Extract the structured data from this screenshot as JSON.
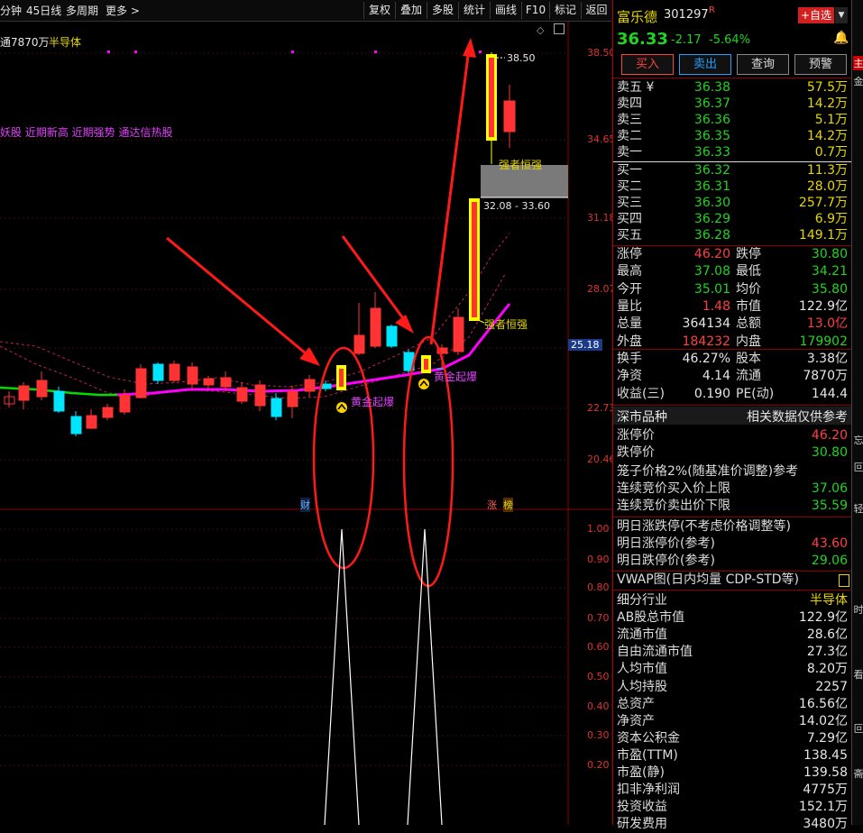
{
  "toolbar": {
    "left_items": [
      "分钟",
      "45日线",
      "多周期",
      "更多 >"
    ],
    "right_items": [
      "复权",
      "叠加",
      "多股",
      "统计",
      "画线",
      "F10",
      "标记",
      "返回"
    ]
  },
  "chart": {
    "info_line": "通7870万",
    "sector_tag": "半导体",
    "concept_line": "妖股 近期新高 近期强势 通达信热股",
    "y_axis": [
      "38.50",
      "34.65",
      "31.18",
      "28.07",
      "22.73",
      "20.46"
    ],
    "current_price_tag": "25.18",
    "lower_axis": [
      "1.00",
      "0.90",
      "0.80",
      "0.70",
      "0.60",
      "0.50",
      "0.40",
      "0.30",
      "0.20"
    ],
    "high_label": "38.50",
    "range_label": "32.08 - 33.60",
    "strong_label_1": "强者恒强",
    "strong_label_2": "强者恒强",
    "gold_label_1": "黄金起爆",
    "gold_label_2": "黄金起爆",
    "marker_finance": "财",
    "marker_limit": "涨",
    "marker_list": "榜",
    "colors": {
      "up": "#ff3030",
      "down": "#00e5ff",
      "ma_main": "#ff00ff",
      "ma_green": "#00ff00",
      "signal": "#ffff00"
    }
  },
  "stock": {
    "name": "富乐德",
    "code": "301297",
    "flag": "R",
    "add_watch": "+自选",
    "price": "36.33",
    "change": "-2.17",
    "change_pct": "-5.64%",
    "buttons": [
      "买入",
      "卖出",
      "查询",
      "预警"
    ]
  },
  "order_book": {
    "asks": [
      {
        "label": "卖五 ¥",
        "price": "36.38",
        "vol": "57.5万"
      },
      {
        "label": "卖四",
        "price": "36.37",
        "vol": "14.2万"
      },
      {
        "label": "卖三",
        "price": "36.36",
        "vol": "5.1万"
      },
      {
        "label": "卖二",
        "price": "36.35",
        "vol": "14.2万"
      },
      {
        "label": "卖一",
        "price": "36.33",
        "vol": "0.7万"
      }
    ],
    "bids": [
      {
        "label": "买一",
        "price": "36.32",
        "vol": "11.3万"
      },
      {
        "label": "买二",
        "price": "36.31",
        "vol": "28.0万"
      },
      {
        "label": "买三",
        "price": "36.30",
        "vol": "257.7万"
      },
      {
        "label": "买四",
        "price": "36.29",
        "vol": "6.9万"
      },
      {
        "label": "买五",
        "price": "36.28",
        "vol": "149.1万"
      }
    ]
  },
  "stats1": [
    {
      "l1": "涨停",
      "v1": "46.20",
      "c1": "red",
      "l2": "跌停",
      "v2": "30.80",
      "c2": "green"
    },
    {
      "l1": "最高",
      "v1": "37.08",
      "c1": "green",
      "l2": "最低",
      "v2": "34.21",
      "c2": "green"
    },
    {
      "l1": "今开",
      "v1": "35.01",
      "c1": "green",
      "l2": "均价",
      "v2": "35.80",
      "c2": "green"
    },
    {
      "l1": "量比",
      "v1": "1.48",
      "c1": "red",
      "l2": "市值",
      "v2": "122.9亿",
      "c2": "white"
    },
    {
      "l1": "总量",
      "v1": "364134",
      "c1": "white",
      "l2": "总额",
      "v2": "13.0亿",
      "c2": "red"
    },
    {
      "l1": "外盘",
      "v1": "184232",
      "c1": "red",
      "l2": "内盘",
      "v2": "179902",
      "c2": "green"
    }
  ],
  "stats2": [
    {
      "l1": "换手",
      "v1": "46.27%",
      "c1": "white",
      "l2": "股本",
      "v2": "3.38亿",
      "c2": "white"
    },
    {
      "l1": "净资",
      "v1": "4.14",
      "c1": "white",
      "l2": "流通",
      "v2": "7870万",
      "c2": "white"
    },
    {
      "l1": "收益(三)",
      "v1": "0.190",
      "c1": "white",
      "l2": "PE(动)",
      "v2": "144.4",
      "c2": "white"
    }
  ],
  "market": {
    "tab_left": "深市品种",
    "tab_right": "相关数据仅供参考",
    "limit_up_label": "涨停价",
    "limit_up": "46.20",
    "limit_down_label": "跌停价",
    "limit_down": "30.80",
    "cage_label": "笼子价格2%(随基准价调整)参考",
    "auction_buy_label": "连续竞价买入价上限",
    "auction_buy": "37.06",
    "auction_sell_label": "连续竞价卖出价下限",
    "auction_sell": "35.59",
    "next_title": "明日涨跌停(不考虑价格调整等)",
    "next_up_label": "明日涨停价(参考)",
    "next_up": "43.60",
    "next_down_label": "明日跌停价(参考)",
    "next_down": "29.06",
    "vwap": "VWAP图(日内均量 CDP-STD等)"
  },
  "fundamentals": [
    {
      "label": "细分行业",
      "value": "半导体",
      "c": "yellow"
    },
    {
      "label": "AB股总市值",
      "value": "122.9亿",
      "c": "white"
    },
    {
      "label": "流通市值",
      "value": "28.6亿",
      "c": "white"
    },
    {
      "label": "自由流通市值",
      "value": "27.3亿",
      "c": "white"
    },
    {
      "label": "人均市值",
      "value": "8.20万",
      "c": "white"
    },
    {
      "label": "人均持股",
      "value": "2257",
      "c": "white"
    },
    {
      "label": "总资产",
      "value": "16.56亿",
      "c": "white"
    },
    {
      "label": "净资产",
      "value": "14.02亿",
      "c": "white"
    },
    {
      "label": "资本公积金",
      "value": "7.29亿",
      "c": "white"
    },
    {
      "label": "市盈(TTM)",
      "value": "138.45",
      "c": "white"
    },
    {
      "label": "市盈(静)",
      "value": "139.58",
      "c": "white"
    },
    {
      "label": "扣非净利润",
      "value": "4775万",
      "c": "white"
    },
    {
      "label": "投资收益",
      "value": "152.1万",
      "c": "white"
    },
    {
      "label": "研发费用",
      "value": "3480万",
      "c": "white"
    }
  ],
  "edge_tabs": [
    "主",
    "金",
    "忘",
    "叵",
    "轻",
    "时",
    "看",
    "叵",
    "斋"
  ]
}
